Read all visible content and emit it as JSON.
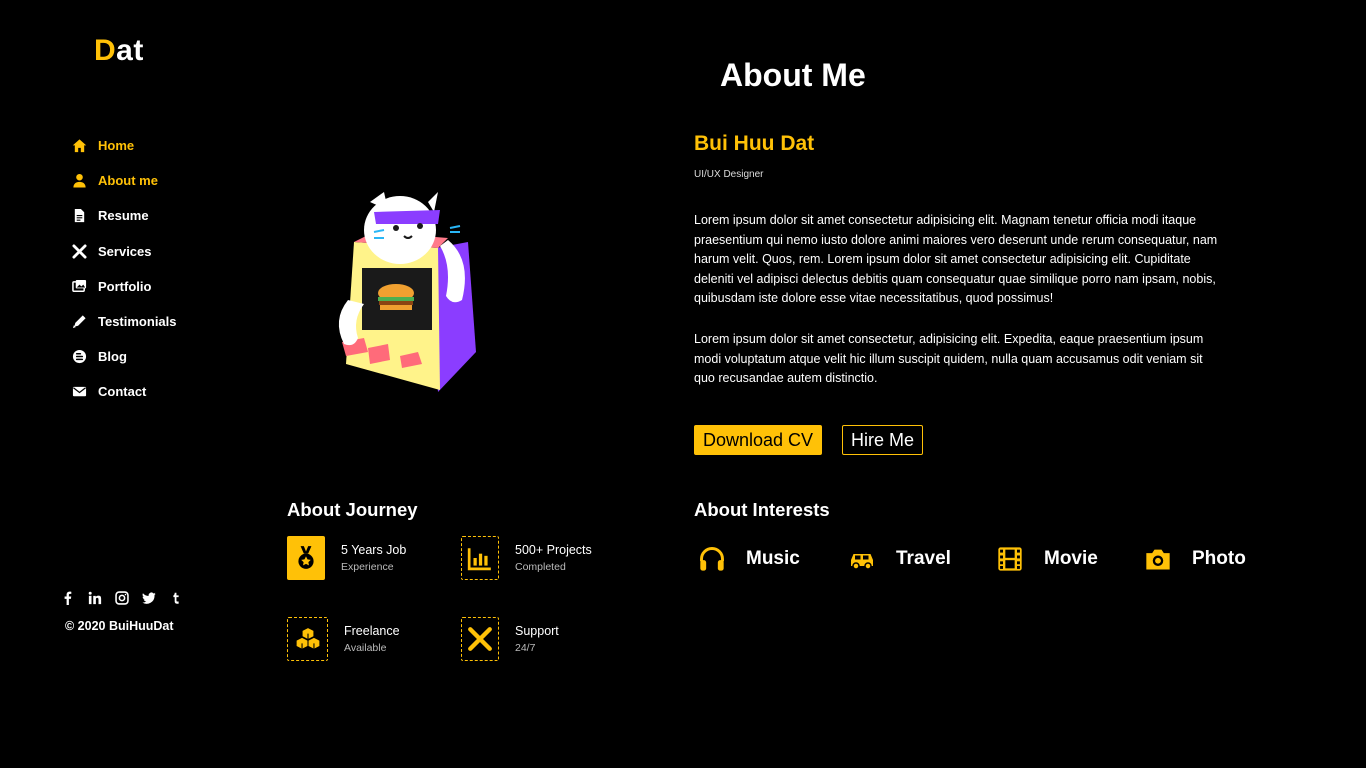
{
  "brand": {
    "first_letter": "D",
    "rest": "at",
    "accent": "#ffc107"
  },
  "nav": {
    "items": [
      {
        "label": "Home",
        "icon": "home-icon"
      },
      {
        "label": "About me",
        "icon": "user-icon"
      },
      {
        "label": "Resume",
        "icon": "file-icon"
      },
      {
        "label": "Services",
        "icon": "tools-icon"
      },
      {
        "label": "Portfolio",
        "icon": "images-icon"
      },
      {
        "label": "Testimonials",
        "icon": "pen-icon"
      },
      {
        "label": "Blog",
        "icon": "blogger-icon"
      },
      {
        "label": "Contact",
        "icon": "envelope-icon"
      }
    ],
    "active_items": [
      "Home",
      "About me"
    ]
  },
  "socials": [
    "facebook-icon",
    "linkedin-icon",
    "instagram-icon",
    "twitter-icon",
    "tumblr-icon"
  ],
  "footer": {
    "copyright": "© 2020 BuiHuuDat"
  },
  "about": {
    "title": "About Me",
    "name": "Bui Huu Dat",
    "role": "UI/UX Designer",
    "paragraph1": "Lorem ipsum dolor sit amet consectetur adipisicing elit. Magnam tenetur officia modi itaque praesentium qui nemo iusto dolore animi maiores vero deserunt unde rerum consequatur, nam harum velit. Quos, rem. Lorem ipsum dolor sit amet consectetur adipisicing elit. Cupiditate deleniti vel adipisci delectus debitis quam consequatur quae similique porro nam ipsam, nobis, quibusdam iste dolore esse vitae necessitatibus, quod possimus!",
    "paragraph2": "Lorem ipsum dolor sit amet consectetur, adipisicing elit. Expedita, eaque praesentium ipsum modi voluptatum atque velit hic illum suscipit quidem, nulla quam accusamus odit veniam sit quo recusandae autem distinctio.",
    "download_label": "Download CV",
    "hire_label": "Hire Me"
  },
  "journey": {
    "title": "About Journey",
    "items": [
      {
        "title": "5 Years Job",
        "subtitle": "Experience",
        "icon": "medal-icon"
      },
      {
        "title": "500+ Projects",
        "subtitle": "Completed",
        "icon": "chart-icon"
      },
      {
        "title": "Freelance",
        "subtitle": "Available",
        "icon": "cubes-icon"
      },
      {
        "title": "Support",
        "subtitle": "24/7",
        "icon": "tools-icon"
      }
    ]
  },
  "interests": {
    "title": "About Interests",
    "items": [
      {
        "label": "Music",
        "icon": "headphones-icon"
      },
      {
        "label": "Travel",
        "icon": "car-icon"
      },
      {
        "label": "Movie",
        "icon": "film-icon"
      },
      {
        "label": "Photo",
        "icon": "camera-icon"
      }
    ]
  }
}
